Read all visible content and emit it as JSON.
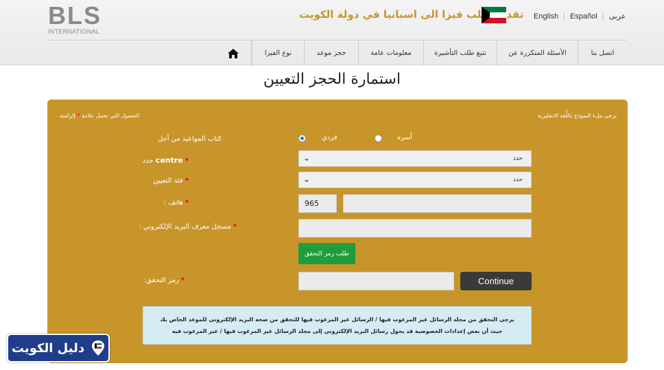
{
  "header": {
    "logo_main": "BLS",
    "logo_sub": "INTERNATIONAL",
    "tagline": "تقدم بطلب فيزا الى اسبانيا في دولة الكويت",
    "languages": [
      "English",
      "Español",
      "عربى"
    ]
  },
  "nav": {
    "items": [
      "اتصل بنا",
      "الأسئلة المتكررة عن",
      "تتبع طلب التأشيرة",
      "معلومات عامة",
      "حجز موعد",
      "نوع الفيزا"
    ]
  },
  "page_title": "استمارة الحجز التعيين",
  "form": {
    "note_right": "يرجى ملء النموذج باللُّغة الانجليزية",
    "note_left_pre": "الحصول التي تحمل علامة",
    "note_left_star": "*",
    "note_left_post": "إلزامية.",
    "appointment_for_label": "كتاب المواعيد من أجل",
    "radio_individual": "فردي",
    "radio_family": "أسره",
    "centre_label_ar": "حدد",
    "centre_label_en": "centre",
    "centre_value": "حدد",
    "category_label": "فئة التعيين",
    "category_value": "حدد",
    "phone_label": "هاتف :",
    "phone_code": "965",
    "phone_value": "",
    "email_label": "مسجل معرف البريد الإلكتروني :",
    "email_value": "",
    "request_code_button": "طلب رمز التحقق",
    "verification_label": "رمز التحقق:",
    "verification_value": "",
    "continue_button": "Continue",
    "required_mark": "*",
    "info_line1": "يرجى التحقق من مجلد الرسائل غير المرغوب فيها / الرسائل غير المرغوب فيها للتحقق من صحة البريد الإلكتروني للموعد الخاص بك",
    "info_line2": "حيث أن بعض إعدادات الخصوصية قد يحول رسائل البريد الإلكتروني إلى مجلد الرسائل غير المرغوب فيها / غير المرغوب فيه"
  },
  "watermark": {
    "text": "دليل الكويت"
  },
  "colors": {
    "panel": "#c8952b",
    "tagline": "#c8952b",
    "button_green": "#1f9d3a",
    "button_dark": "#3a3a3a",
    "info_box": "#d6ecf4",
    "required": "#e00000"
  }
}
